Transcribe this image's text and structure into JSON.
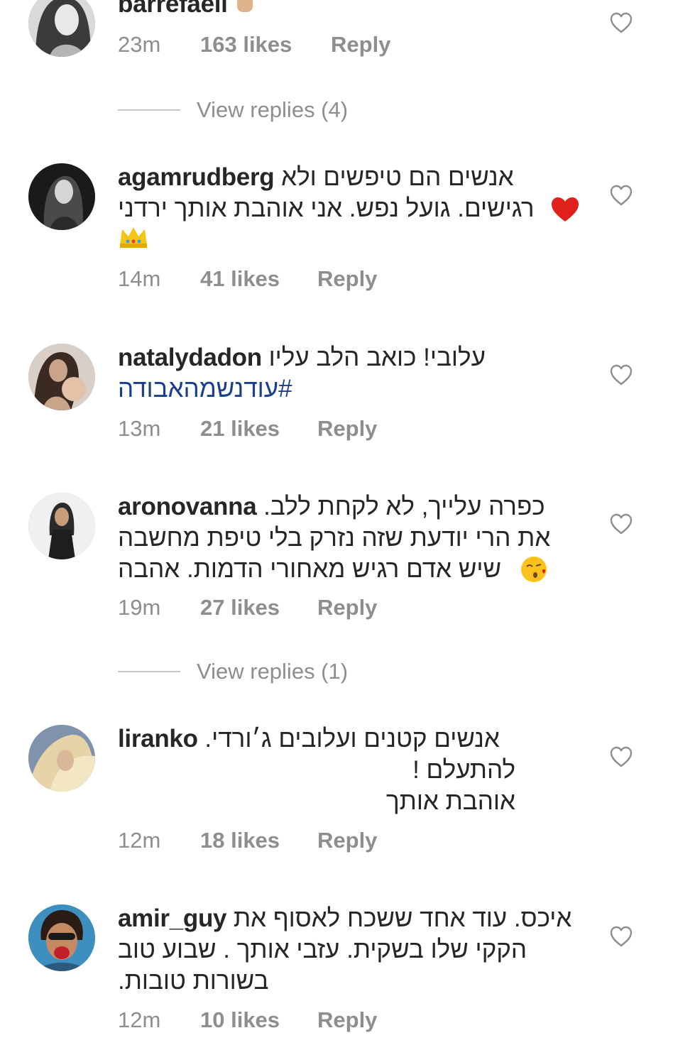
{
  "comments": [
    {
      "username": "barrefaeli",
      "lines": [],
      "time": "23m",
      "likes": "163 likes",
      "reply": "Reply",
      "avatar_icon": "avatar-photo-woman",
      "emoji": "hand-emoji"
    },
    {
      "username": "agamrudberg",
      "lines": [
        "אנשים הם טיפשים ולא",
        "רגישים. גועל נפש. אני אוהבת אותך ירדני"
      ],
      "time": "14m",
      "likes": "41 likes",
      "reply": "Reply",
      "avatar_icon": "avatar-photo-woman",
      "emoji": [
        "red-heart-emoji",
        "crown-emoji"
      ]
    },
    {
      "username": "natalydadon",
      "lines": [
        "עלובי! כואב הלב עליו"
      ],
      "hashtag": "#עודנשמהאבודה",
      "time": "13m",
      "likes": "21 likes",
      "reply": "Reply",
      "avatar_icon": "avatar-photo-mother-baby"
    },
    {
      "username": "aronovanna",
      "lines": [
        "כפרה עלייך, לא לקחת ללב.",
        "את הרי יודעת שזה נזרק בלי טיפת מחשבה",
        "שיש אדם רגיש מאחורי הדמות. אהבה"
      ],
      "time": "19m",
      "likes": "27 likes",
      "reply": "Reply",
      "avatar_icon": "avatar-photo-woman",
      "emoji": "kiss-emoji"
    },
    {
      "username": "liranko",
      "lines": [
        "אנשים קטנים ועלובים ג׳ורדי.",
        "להתעלם !",
        "אוהבת אותך"
      ],
      "time": "12m",
      "likes": "18 likes",
      "reply": "Reply",
      "avatar_icon": "avatar-photo-blonde"
    },
    {
      "username": "amir_guy",
      "lines": [
        "איכס. עוד אחד ששכח לאסוף את",
        "הקקי שלו בשקית. עזבי אותך . שבוע טוב",
        "בשורות טובות."
      ],
      "time": "12m",
      "likes": "10 likes",
      "reply": "Reply",
      "avatar_icon": "avatar-photo-man"
    }
  ],
  "view_replies": [
    "View replies (4)",
    "View replies (1)"
  ],
  "colors": {
    "text": "#262626",
    "meta": "#8e8e8e",
    "hashtag": "#1b3f8f",
    "heart_outline": "#8e8e8e",
    "background": "#ffffff"
  }
}
